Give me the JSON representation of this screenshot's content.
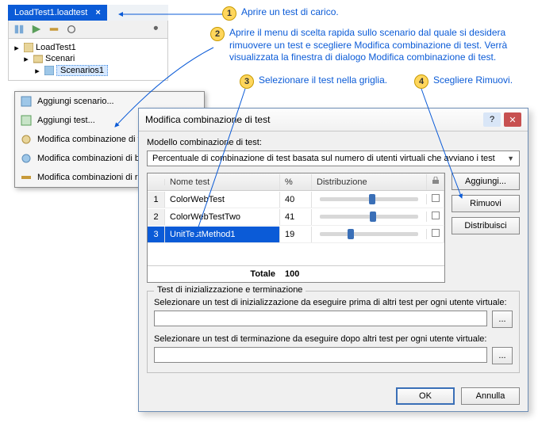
{
  "callouts": {
    "c1": "Aprire un test di carico.",
    "c2": "Aprire il menu di scelta rapida sullo scenario dal quale si desidera rimuovere un test e scegliere Modifica combinazione di test. Verrà visualizzata la finestra di dialogo Modifica combinazione di test.",
    "c3": "Selezionare il test nella griglia.",
    "c4": "Scegliere Rimuovi."
  },
  "tree": {
    "tab_title": "LoadTest1.loadtest",
    "root": "LoadTest1",
    "node_scenari": "Scenari",
    "node_scenarios1": "Scenarios1"
  },
  "context_menu": {
    "item_add_scenario": "Aggiungi scenario...",
    "item_add_test": "Aggiungi test...",
    "item_edit_test_mix": "Modifica combinazione di test...",
    "item_edit_browser_mix": "Modifica combinazioni di browser...",
    "item_edit_network_mix": "Modifica combinazioni di reti..."
  },
  "dialog": {
    "title": "Modifica combinazione di test",
    "model_label": "Modello combinazione di test:",
    "combo_value": "Percentuale di combinazione di test basata sul numero di utenti virtuali che avviano i test",
    "columns": {
      "name": "Nome test",
      "pct": "%",
      "dist": "Distribuzione",
      "lock": ""
    },
    "rows": [
      {
        "num": "1",
        "name": "ColorWebTest",
        "pct": "40",
        "thumb": 50
      },
      {
        "num": "2",
        "name": "ColorWebTestTwo",
        "pct": "41",
        "thumb": 51
      },
      {
        "num": "3",
        "name": "UnitTestMethod1",
        "pct": "19",
        "thumb": 28
      }
    ],
    "total_label": "Totale",
    "total_value": "100",
    "buttons": {
      "add": "Aggiungi...",
      "remove": "Rimuovi",
      "distribute": "Distribuisci"
    },
    "init_group_title": "Test di inizializzazione e terminazione",
    "init_label": "Selezionare un test di inizializzazione da eseguire prima di altri test per ogni utente virtuale:",
    "term_label": "Selezionare un test di terminazione da eseguire dopo altri test per ogni utente virtuale:",
    "browse": "...",
    "ok": "OK",
    "cancel": "Annulla"
  }
}
